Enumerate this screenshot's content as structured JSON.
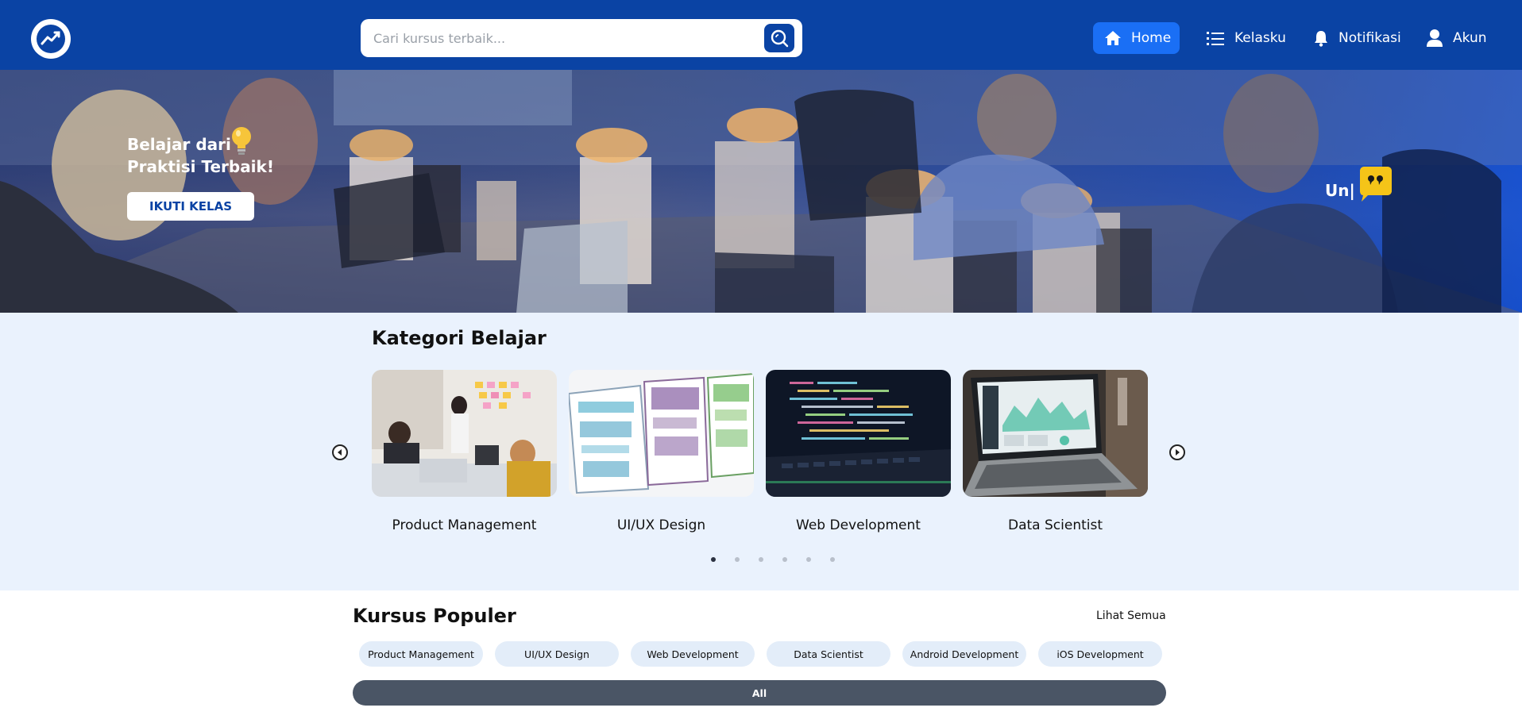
{
  "header": {
    "search": {
      "placeholder": "Cari kursus terbaik..."
    },
    "nav": [
      {
        "label": "Home",
        "icon": "home-icon"
      },
      {
        "label": "Kelasku",
        "icon": "list-icon"
      },
      {
        "label": "Notifikasi",
        "icon": "bell-icon"
      },
      {
        "label": "Akun",
        "icon": "user-icon"
      }
    ]
  },
  "hero": {
    "title_line1": "Belajar dari",
    "title_line2": "Praktisi Terbaik!",
    "cta": "IKUTI KELAS",
    "typed_text": "Un|"
  },
  "kategori": {
    "title": "Kategori Belajar",
    "items": [
      {
        "label": "Product Management"
      },
      {
        "label": "UI/UX Design"
      },
      {
        "label": "Web Development"
      },
      {
        "label": "Data Scientist"
      }
    ],
    "dot_count": 6,
    "active_dot": 1
  },
  "populer": {
    "title": "Kursus Populer",
    "see_all": "Lihat Semua",
    "chips": [
      "Product Management",
      "UI/UX Design",
      "Web Development",
      "Data Scientist",
      "Android Development",
      "iOS Development"
    ],
    "all_label": "All"
  },
  "colors": {
    "primary": "#0a43a4",
    "accent": "#1a6ff5",
    "quote": "#f5c418",
    "bg_light": "#eaf2fd"
  }
}
